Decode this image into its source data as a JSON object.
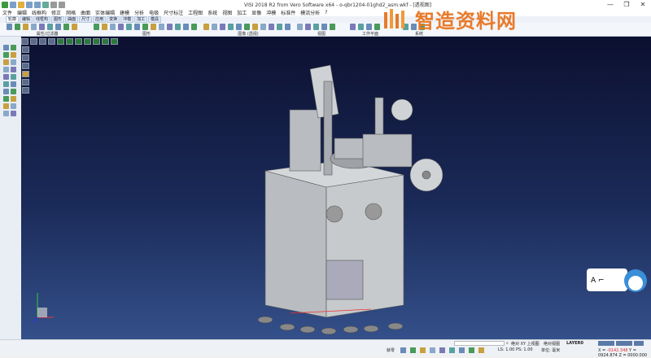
{
  "window": {
    "title": "VISI 2018 R2 from Vero Software x64 - o-qbr1204-01ghd2_asm.wkf - [透视图]",
    "min": "—",
    "max": "❐",
    "close": "✕"
  },
  "menu": [
    "文件",
    "编辑",
    "线框构",
    "修正",
    "网格",
    "曲面",
    "实体编辑",
    "建模",
    "分析",
    "电极",
    "尺寸标注",
    "工程图",
    "系统",
    "视图",
    "加工",
    "显像",
    "冲模",
    "标准件",
    "模流分析",
    "?"
  ],
  "tabs": [
    "轮廓",
    "编辑",
    "线框构",
    "图形",
    "曲面",
    "尺寸",
    "应用",
    "变换",
    "冲模",
    "加工",
    "模具"
  ],
  "active_tab": "轮廓",
  "ribbon_groups": [
    "属性/过滤器",
    "图形",
    "图像 (透视)",
    "视图",
    "工作平面",
    "系统"
  ],
  "watermark": "智造资料网",
  "status": {
    "view_abs": "绝对 XY 上视图",
    "view": "绝对视图",
    "layer": "LAYER0",
    "mode": "就零",
    "ls_ps": "LS: 1.00 PS: 1.00",
    "unit": "单位: 毫米",
    "x_label": "X = ",
    "x": "-0142.348",
    "yz": " Y = 0924.874 Z = 0000.000"
  },
  "colors": {
    "viewport_top": "#0c1030",
    "viewport_bottom": "#34508a",
    "model": "#b8bcc0",
    "accent": "#e87a2a"
  }
}
